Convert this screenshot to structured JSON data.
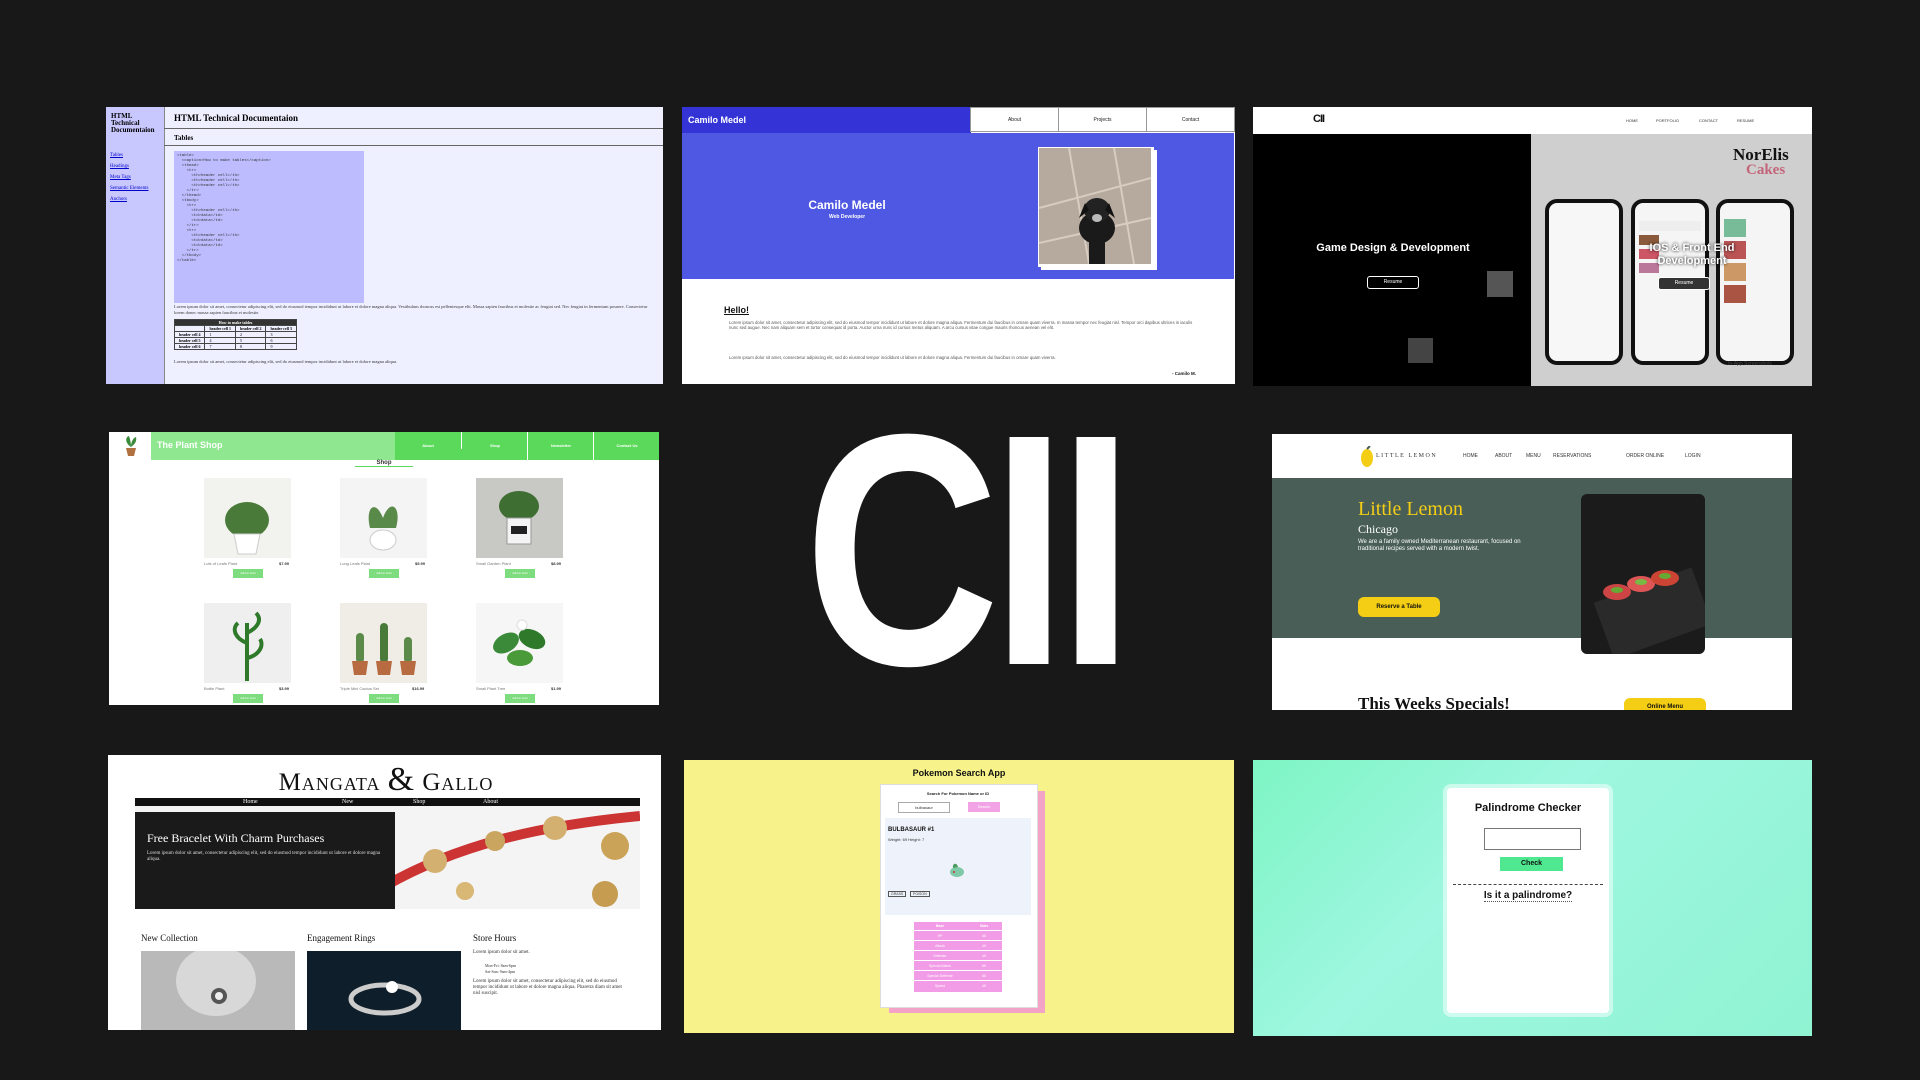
{
  "tile1": {
    "sidebar_title": "HTML Technical Documentaion",
    "nav": [
      "Tables",
      "Headings",
      "Meta Tags",
      "Semantic Elements",
      "Anchors"
    ],
    "heading": "HTML Technical Documentaion",
    "section": "Tables",
    "code": "<table>\n  <caption>How to make tables</caption>\n  <thead>\n    <tr>\n      <th>header cell</th>\n      <th>header cell</th>\n      <th>header cell</th>\n    </tr>\n  </thead>\n  <tbody>\n    <tr>\n      <th>header cell</th>\n      <td>data</td>\n      <td>data</td>\n    </tr>\n    <tr>\n      <th>header cell</th>\n      <td>data</td>\n      <td>data</td>\n    </tr>\n  </tbody>\n</table>",
    "paragraph": "Lorem ipsum dolor sit amet, consectetur adipiscing elit, sed do eiusmod tempor incididunt ut labore et dolore magna aliqua. Vestibulum rhoncus est pellentesque elit. Massa sapien faucibus et molestie ac feugiat sed. Nec feugiat in fermentum posuere. Consectetur lorem donec massa sapien faucibus et molestie.",
    "table_caption": "How to make tables",
    "table_headers": [
      "",
      "header cell 1",
      "header cell 2",
      "header cell 3"
    ],
    "table_rows": [
      [
        "header cell 4",
        "1",
        "2",
        "3"
      ],
      [
        "header cell 5",
        "4",
        "5",
        "6"
      ],
      [
        "header cell 6",
        "7",
        "8",
        "9"
      ]
    ],
    "footer_paragraph": "Lorem ipsum dolor sit amet, consectetur adipiscing elit, sed do eiusmod tempor incididunt ut labore et dolore magna aliqua."
  },
  "tile2": {
    "brand": "Camilo Medel",
    "nav": [
      "About",
      "Projects",
      "Contact"
    ],
    "hero_name": "Camilo Medel",
    "hero_role": "Web Developer",
    "hello": "Hello!",
    "body": "Lorem ipsum dolor sit amet, consectetur adipiscing elit, sed do eiusmod tempor incididunt ut labore et dolore magna aliqua. Fermentum dui faucibus in ornare quam viverra. In massa tempor nec feugiat nisl. Tempor orci dapibus ultrices in iaculis nunc sed augue. Nec nam aliquam sem et tortor consequat id porta. Auctor urna nunc id cursus metus aliquam. A arcu cursus vitae congue mauris rhoncus aenean vel elit.",
    "body2": "Lorem ipsum dolor sit amet, consectetur adipiscing elit, sed do eiusmod tempor incididunt ut labore et dolore magna aliqua. Fermentum dui faucibus in ornare quam viverra.",
    "sign": "- Camilo M."
  },
  "tile3": {
    "logo": "CII",
    "nav": [
      "HOME",
      "PORTFOLIO",
      "CONTACT",
      "RESUME"
    ],
    "left_title": "Game Design & Development",
    "left_btn": "Resume",
    "right_title": "IOS & Front End Development",
    "right_btn": "Resume",
    "brand1": "NorElis",
    "brand2": "Cakes",
    "caption": "In-App Screenshots"
  },
  "tile4": {
    "brand": "The Plant Shop",
    "nav": [
      "About",
      "Shop",
      "Newsletter",
      "Contact Us"
    ],
    "shop": "Shop",
    "items": [
      {
        "name": "Lots of Leafs Plant",
        "price": "$7.99",
        "btn": "Add to Cart"
      },
      {
        "name": "Long Leafs Plant",
        "price": "$5.99",
        "btn": "Add to Cart"
      },
      {
        "name": "Small Garden Plant",
        "price": "$8.99",
        "btn": "Add to Cart"
      },
      {
        "name": "Bottle Plant",
        "price": "$3.99",
        "btn": "Add to Cart"
      },
      {
        "name": "Triple Mini Cactus Set",
        "price": "$16.99",
        "btn": "Add to Cart"
      },
      {
        "name": "Small Plant Tree",
        "price": "$1.99",
        "btn": "Add to Cart"
      }
    ]
  },
  "center_logo": "CII",
  "tile6": {
    "logo": "LITTLE LEMON",
    "nav": [
      "HOME",
      "ABOUT",
      "MENU",
      "RESERVATIONS",
      "ORDER ONLINE",
      "LOGIN"
    ],
    "title": "Little Lemon",
    "city": "Chicago",
    "desc": "We are a family owned Mediterranean restaurant, focused on traditional recipes served with a modern twist.",
    "btn": "Reserve a Table",
    "specials": "This Weeks Specials!",
    "menu_btn": "Online Menu"
  },
  "tile7": {
    "title1": "Mangata",
    "amp": "&",
    "title2": "Gallo",
    "nav": [
      "Home",
      "New",
      "Shop",
      "About"
    ],
    "promo": "Free Bracelet With Charm Purchases",
    "promo_text": "Lorem ipsum dolor sit amet, consectetur adipiscing elit, sed do eiusmod tempor incididunt ut labore et dolore magna aliqua.",
    "col1": "New Collection",
    "col2": "Engagement Rings",
    "col3": "Store Hours",
    "hours_intro": "Lorem ipsum dolor sit amet.",
    "hours": [
      "Mon-Fri: 8am-6pm",
      "Sat-Sun: 9am-4pm"
    ],
    "hours_text": "Lorem ipsum dolor sit amet, consectetur adipiscing elit, sed do eiusmod tempor incididunt ut labore et dolore magna aliqua. Pharetra diam sit amet nisl suscipit."
  },
  "tile8": {
    "title": "Pokemon Search App",
    "label": "Search For Pokemon Name or ID",
    "input": "bulbasaur",
    "btn": "Search",
    "name": "BULBASAUR #1",
    "stats_line": "Weight: 69 Height: 7",
    "types": [
      "GRASS",
      "POISON"
    ],
    "table_head": [
      "Base",
      "Stats"
    ],
    "table": [
      [
        "HP",
        "45"
      ],
      [
        "Attack",
        "49"
      ],
      [
        "Defense",
        "49"
      ],
      [
        "Special Attack",
        "65"
      ],
      [
        "Special Defense",
        "65"
      ],
      [
        "Speed",
        "45"
      ]
    ]
  },
  "tile9": {
    "title": "Palindrome Checker",
    "btn": "Check",
    "question": "Is it a palindrome?"
  }
}
